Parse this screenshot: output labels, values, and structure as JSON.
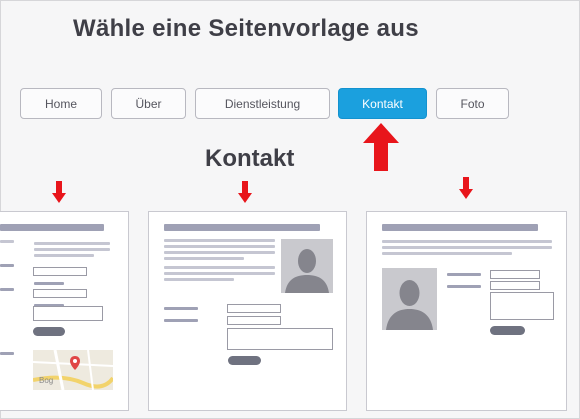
{
  "page": {
    "title": "Wähle eine Seitenvorlage aus",
    "section_title": "Kontakt"
  },
  "tabs": [
    {
      "label": "Home",
      "active": false
    },
    {
      "label": "Über",
      "active": false
    },
    {
      "label": "Dienstleistung",
      "active": false
    },
    {
      "label": "Kontakt",
      "active": true
    },
    {
      "label": "Foto",
      "active": false
    }
  ],
  "map": {
    "label": "Bog"
  },
  "colors": {
    "accent": "#1ba0de",
    "arrow": "#e8151b",
    "heading": "#3f3f47",
    "placeholder_bar": "#9fa1b5",
    "text_line": "#c5c6d2",
    "button": "#6f7280"
  }
}
